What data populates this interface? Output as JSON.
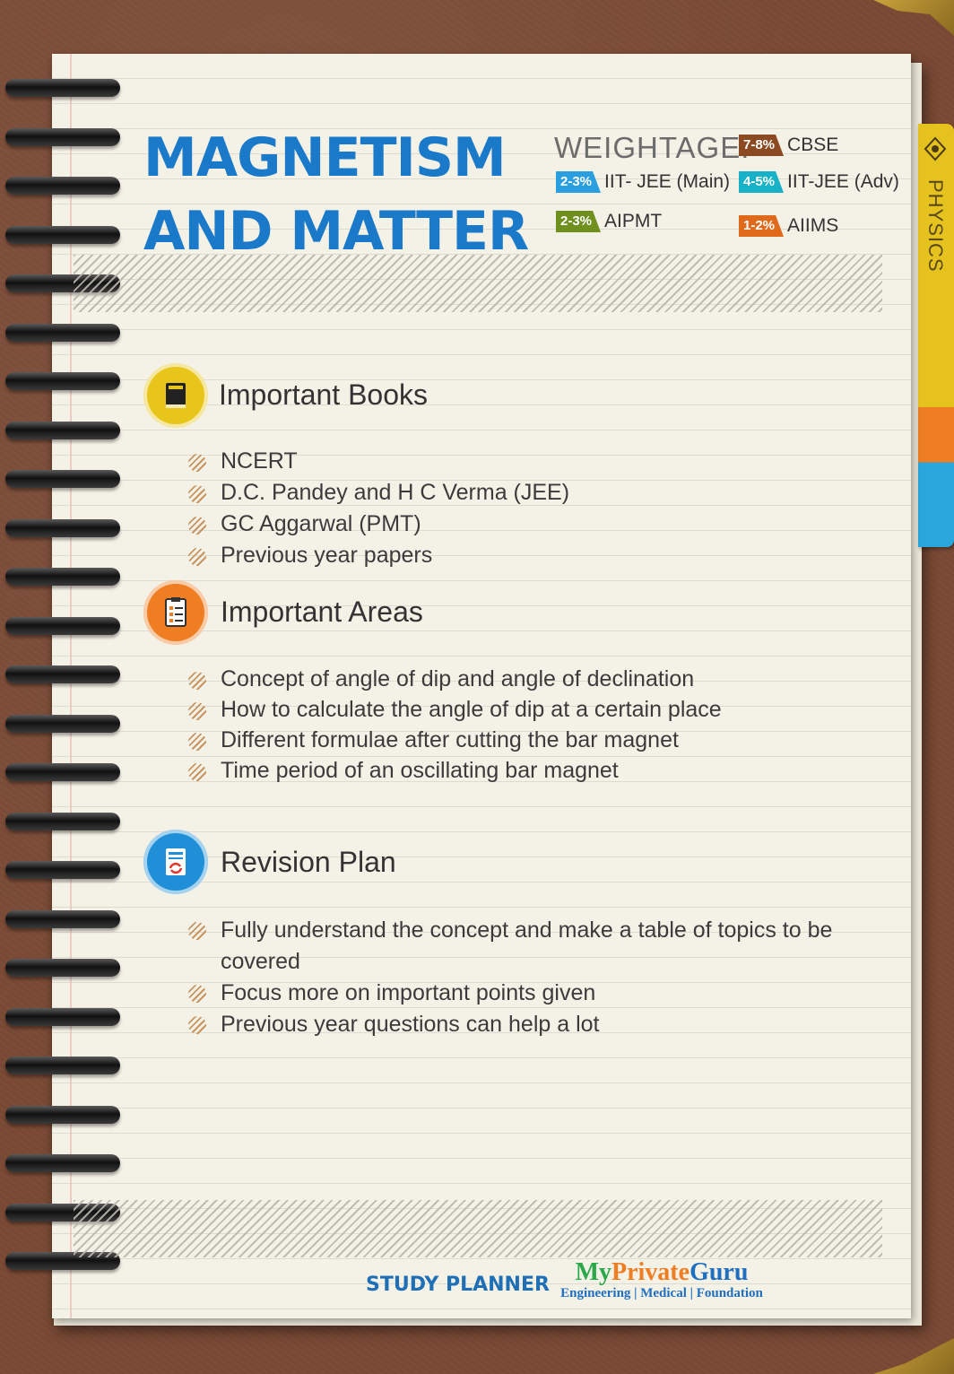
{
  "title": {
    "line1": "MAGNETISM",
    "line2": "AND MATTER"
  },
  "weightage": {
    "label": "WEIGHTAGE:",
    "items": [
      {
        "badge": "7-8%",
        "name": "CBSE",
        "color": "#8b4a22"
      },
      {
        "badge": "2-3%",
        "name": "IIT- JEE (Main)",
        "color": "#2a9fe0"
      },
      {
        "badge": "4-5%",
        "name": "IIT-JEE (Adv)",
        "color": "#18b2c8"
      },
      {
        "badge": "2-3%",
        "name": "AIPMT",
        "color": "#6f8f1e"
      },
      {
        "badge": "1-2%",
        "name": "AIIMS",
        "color": "#e06a1c"
      }
    ]
  },
  "side_tab": {
    "label": "PHYSICS",
    "icon": "physics-icon"
  },
  "sections": {
    "books": {
      "title": "Important Books",
      "icon": "book-icon",
      "icon_color": "#e8c51a",
      "items": [
        "NCERT",
        "D.C. Pandey and H C Verma (JEE)",
        "GC Aggarwal (PMT)",
        "Previous year papers"
      ]
    },
    "areas": {
      "title": "Important Areas",
      "icon": "checklist-icon",
      "icon_color": "#ef7d22",
      "items": [
        "Concept of angle of dip and angle of declination",
        "How to calculate the angle of dip at a certain place",
        "Different formulae after cutting the bar magnet",
        "Time period of an oscillating bar magnet"
      ]
    },
    "revision": {
      "title": "Revision Plan",
      "icon": "revision-icon",
      "icon_color": "#1f8fd8",
      "items": [
        "Fully understand the concept and make a table of topics to be covered",
        "Focus more on important points given",
        "Previous year questions can help a lot"
      ]
    }
  },
  "footer": {
    "title": "STUDY PLANNER",
    "brand_part1": "My",
    "brand_part2": "Private",
    "brand_part3": "Guru",
    "brand_tagline": "Engineering | Medical | Foundation"
  }
}
